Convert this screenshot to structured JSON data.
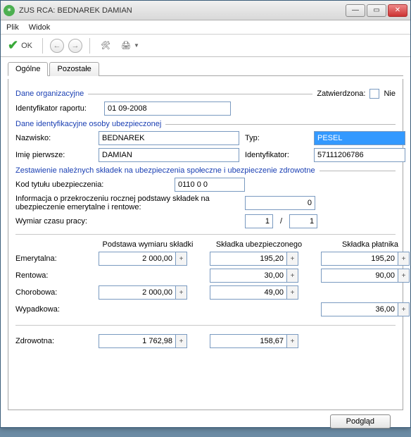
{
  "window": {
    "title": "ZUS RCA: BEDNAREK DAMIAN"
  },
  "menu": {
    "file": "Plik",
    "view": "Widok"
  },
  "toolbar": {
    "ok": "OK"
  },
  "tabs": {
    "general": "Ogólne",
    "other": "Pozostałe"
  },
  "section_org": {
    "legend": "Dane organizacyjne",
    "approved_label": "Zatwierdzona:",
    "approved_text": "Nie",
    "report_id_label": "Identyfikator raportu:",
    "report_id_value": "01 09-2008"
  },
  "section_ident": {
    "legend": "Dane identyfikacyjne osoby ubezpieczonej",
    "surname_label": "Nazwisko:",
    "surname_value": "BEDNAREK",
    "firstname_label": "Imię pierwsze:",
    "firstname_value": "DAMIAN",
    "type_label": "Typ:",
    "type_value": "PESEL",
    "id_label": "Identyfikator:",
    "id_value": "57111206786"
  },
  "section_contrib": {
    "legend": "Zestawienie należnych składek na ubezpieczenia społeczne i ubezpieczenie zdrowotne",
    "code_label": "Kod tytułu ubezpieczenia:",
    "code_value": "0110 0 0",
    "excess_label": "Informacja o przekroczeniu rocznej podstawy składek na ubezpieczenie emerytalne i rentowe:",
    "excess_value": "0",
    "worktime_label": "Wymiar czasu pracy:",
    "worktime_num": "1",
    "worktime_den": "1"
  },
  "columns": {
    "base": "Podstawa wymiaru składki",
    "insured": "Składka ubezpieczonego",
    "payer": "Składka płatnika"
  },
  "rows": {
    "emerytalna": {
      "label": "Emerytalna:",
      "base": "2 000,00",
      "insured": "195,20",
      "payer": "195,20"
    },
    "rentowa": {
      "label": "Rentowa:",
      "base": "",
      "insured": "30,00",
      "payer": "90,00"
    },
    "chorobowa": {
      "label": "Chorobowa:",
      "base": "2 000,00",
      "insured": "49,00",
      "payer": ""
    },
    "wypadkowa": {
      "label": "Wypadkowa:",
      "base": "",
      "insured": "",
      "payer": "36,00"
    },
    "zdrowotna": {
      "label": "Zdrowotna:",
      "base": "1 762,98",
      "insured": "158,67",
      "payer": ""
    }
  },
  "footer": {
    "preview": "Podgląd"
  }
}
